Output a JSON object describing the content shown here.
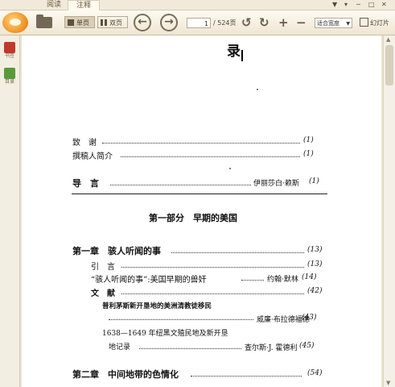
{
  "tabs": [
    {
      "label": "阅读",
      "active": false
    },
    {
      "label": "注释",
      "active": true
    }
  ],
  "window_controls": [
    "▼",
    "▾",
    "─",
    "□",
    "✕"
  ],
  "toolbar": {
    "single_page_label": "单页",
    "double_page_label": "双页",
    "current_page": "1",
    "total_pages": "/ 524页",
    "zoom_value": "适合宽度",
    "slideshow_label": "幻灯片"
  },
  "sidebar": [
    {
      "label": "书签",
      "color": "#c0392b"
    },
    {
      "label": "目录",
      "color": "#5a9a3a"
    }
  ],
  "page": {
    "title": "录",
    "front_matter": [
      {
        "title": "致　谢",
        "page": "(1)"
      },
      {
        "title": "撰稿人简介",
        "page": "(1)"
      }
    ],
    "intro": {
      "title": "导　言",
      "author": "伊丽莎白·赖斯",
      "page": "(1)"
    },
    "part_title": "第一部分　早期的美国",
    "chapter1": {
      "title": "第一章　骇人听闻的事",
      "page": "(13)",
      "entries": [
        {
          "title": "引　言",
          "author": "",
          "page": "(13)"
        },
        {
          "title": "“骇人听闻的事”:美国早期的兽奸",
          "author": "约翰·默林",
          "page": "(14)"
        },
        {
          "title": "文　献",
          "author": "",
          "page": "(42)"
        }
      ],
      "documents": [
        {
          "line1": "普利茅斯新开垦地的美洲清教徒移民",
          "line2": "",
          "author": "威廉·布拉德福德",
          "page": "(43)"
        },
        {
          "line1": "1638—1649 年纽黑文殖民地及新开垦",
          "line2": "地记录",
          "author": "查尔斯·J. 霍德利",
          "page": "(45)"
        }
      ]
    },
    "chapter2": {
      "title": "第二章　中间地带的色情化",
      "page": "(54)"
    }
  }
}
